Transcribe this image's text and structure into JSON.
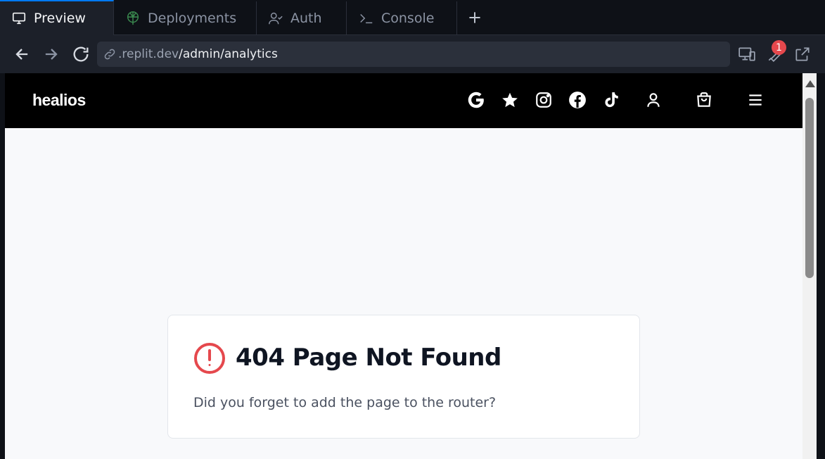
{
  "tabs": [
    {
      "label": "Preview",
      "icon": "monitor-icon",
      "active": true
    },
    {
      "label": "Deployments",
      "icon": "deployments-icon",
      "active": false
    },
    {
      "label": "Auth",
      "icon": "user-check-icon",
      "active": false
    },
    {
      "label": "Console",
      "icon": "terminal-icon",
      "active": false
    }
  ],
  "address_bar": {
    "host": ".replit.dev",
    "path": "/admin/analytics"
  },
  "devtools_badge": "1",
  "site": {
    "logo": "healios",
    "nav_icons": [
      "google-icon",
      "star-icon",
      "instagram-icon",
      "facebook-icon",
      "tiktok-icon",
      "user-icon",
      "shopping-bag-icon",
      "menu-icon"
    ]
  },
  "error_card": {
    "title": "404 Page Not Found",
    "message": "Did you forget to add the page to the router?"
  },
  "colors": {
    "active_tab_accent": "#0079f2",
    "error_red": "#e5484d",
    "site_header": "#000000"
  }
}
